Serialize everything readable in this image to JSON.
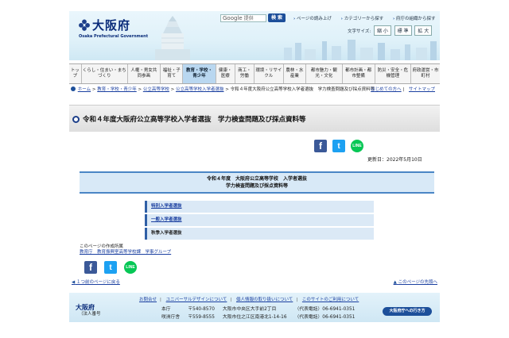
{
  "header": {
    "logo_ja": "大阪府",
    "logo_en": "Osaka Prefectural Government",
    "search_google": "Google",
    "search_placeholder": "提供",
    "search_button": "検 索",
    "links": [
      "ページの読み上げ",
      "カテゴリーから探す",
      "府庁の組織から探す"
    ],
    "font_size_label": "文字サイズ:",
    "font_sizes": [
      "縮 小",
      "標 準",
      "拡 大"
    ]
  },
  "nav": [
    "トップ",
    "くらし・住まい・まちづくり",
    "人権・男女共同参画",
    "福祉・子育て",
    "教育・学校・青少年",
    "健康・医療",
    "商工・労働",
    "環境・リサイクル",
    "農林・水産業",
    "都市魅力・観光・文化",
    "都市計画・都市整備",
    "防災・安全・危機管理",
    "府政運営・市町村"
  ],
  "breadcrumb": {
    "items": [
      "ホーム",
      "教育・学校・青少年",
      "公立高等学校",
      "公立高等学校入学者選抜"
    ],
    "current": "令和４年度大阪府公立高等学校入学者選抜　学力検査問題及び採点資料等",
    "first_visit": "はじめての方へ",
    "sitemap": "サイトマップ"
  },
  "page_title": "令和４年度大阪府公立高等学校入学者選抜　学力検査問題及び採点資料等",
  "updated": "更新日：2022年5月10日",
  "info": {
    "line1": "令和４年度　大阪府公立高等学校　入学者選抜",
    "line2": "学力検査問題及び採点資料等"
  },
  "list": [
    {
      "label": "特別入学者選抜",
      "link": true
    },
    {
      "label": "一般入学者選抜",
      "link": true
    },
    {
      "label": "秋季入学者選抜",
      "link": false
    }
  ],
  "author": {
    "heading": "このページの作成所属",
    "dept": "教育庁　教育振興室高等学校課　学事グループ"
  },
  "pagenav": {
    "prev": "１つ前のページに戻る",
    "top": "このページの先頭へ"
  },
  "footer": {
    "links": [
      "お問合せ",
      "ユニバーサルデザインについて",
      "個人情報の取り扱いについて",
      "このサイトのご利用について"
    ],
    "org_name": "大阪府",
    "org_number": "（法人番号",
    "addr_rows": [
      [
        "本庁",
        "〒540-8570",
        "大阪市中央区大手前2丁目",
        "（代表電話）06-6941-0351"
      ],
      [
        "咲洲庁舎",
        "〒559-8555",
        "大阪市住之江区南港北1-14-16",
        "（代表電話）06-6941-0351"
      ]
    ],
    "access_button": "大阪府庁への行き方"
  },
  "colors": {
    "accent": "#1d4f9a",
    "nav_active": "#b9d7f0",
    "info_bg": "#d8e9f7",
    "facebook": "#3b5998",
    "twitter": "#1da1f2",
    "line": "#06c755"
  }
}
